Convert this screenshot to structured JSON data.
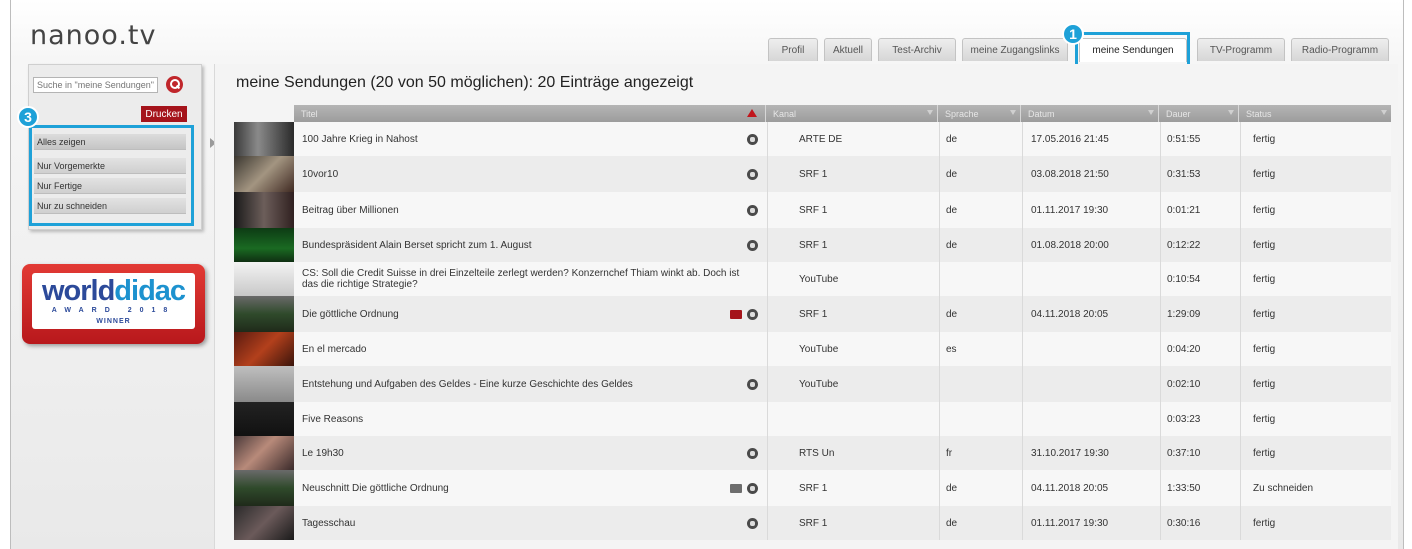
{
  "logo": "nanoo.tv",
  "tabs": [
    "Profil",
    "Aktuell",
    "Test-Archiv",
    "meine Zugangslinks",
    "meine Sendungen",
    "TV-Programm",
    "Radio-Programm"
  ],
  "active_tab": "meine Sendungen",
  "badges": {
    "tab": "1",
    "filters": "3"
  },
  "search": {
    "placeholder": "Suche in \"meine Sendungen\""
  },
  "print_label": "Drucken",
  "filters": [
    "Alles zeigen",
    "Nur Vorgemerkte",
    "Nur Fertige",
    "Nur zu schneiden"
  ],
  "award": {
    "world": "world",
    "didac": "didac",
    "line": "AWARD 2018",
    "winner": "WINNER"
  },
  "page_title": "meine Sendungen (20 von 50 möglichen): 20 Einträge angezeigt",
  "columns": [
    "Titel",
    "Kanal",
    "Sprache",
    "Datum",
    "Dauer",
    "Status"
  ],
  "rows": [
    {
      "title": "100 Jahre Krieg in Nahost",
      "kanal": "ARTE DE",
      "sprache": "de",
      "datum": "17.05.2016 21:45",
      "dauer": "0:51:55",
      "status": "fertig",
      "info": true,
      "folder": ""
    },
    {
      "title": "10vor10",
      "kanal": "SRF 1",
      "sprache": "de",
      "datum": "03.08.2018 21:50",
      "dauer": "0:31:53",
      "status": "fertig",
      "info": true,
      "folder": ""
    },
    {
      "title": "Beitrag über Millionen",
      "kanal": "SRF 1",
      "sprache": "de",
      "datum": "01.11.2017 19:30",
      "dauer": "0:01:21",
      "status": "fertig",
      "info": true,
      "folder": ""
    },
    {
      "title": "Bundespräsident Alain Berset spricht zum 1. August",
      "kanal": "SRF 1",
      "sprache": "de",
      "datum": "01.08.2018 20:00",
      "dauer": "0:12:22",
      "status": "fertig",
      "info": true,
      "folder": ""
    },
    {
      "title": "CS: Soll die Credit Suisse in drei Einzelteile zerlegt werden? Konzernchef Thiam winkt ab. Doch ist das die richtige Strategie?",
      "kanal": "YouTube",
      "sprache": "",
      "datum": "",
      "dauer": "0:10:54",
      "status": "fertig",
      "info": false,
      "folder": ""
    },
    {
      "title": "Die göttliche Ordnung",
      "kanal": "SRF 1",
      "sprache": "de",
      "datum": "04.11.2018 20:05",
      "dauer": "1:29:09",
      "status": "fertig",
      "info": true,
      "folder": "#a5141b"
    },
    {
      "title": "En el mercado",
      "kanal": "YouTube",
      "sprache": "es",
      "datum": "",
      "dauer": "0:04:20",
      "status": "fertig",
      "info": false,
      "folder": ""
    },
    {
      "title": "Entstehung und Aufgaben des Geldes - Eine kurze Geschichte des Geldes",
      "kanal": "YouTube",
      "sprache": "",
      "datum": "",
      "dauer": "0:02:10",
      "status": "fertig",
      "info": true,
      "folder": ""
    },
    {
      "title": "Five Reasons",
      "kanal": "",
      "sprache": "",
      "datum": "",
      "dauer": "0:03:23",
      "status": "fertig",
      "info": false,
      "folder": ""
    },
    {
      "title": "Le 19h30",
      "kanal": "RTS Un",
      "sprache": "fr",
      "datum": "31.10.2017 19:30",
      "dauer": "0:37:10",
      "status": "fertig",
      "info": true,
      "folder": ""
    },
    {
      "title": "Neuschnitt Die göttliche Ordnung",
      "kanal": "SRF 1",
      "sprache": "de",
      "datum": "04.11.2018 20:05",
      "dauer": "1:33:50",
      "status": "Zu schneiden",
      "info": true,
      "folder": "#6d6d6d"
    },
    {
      "title": "Tagesschau",
      "kanal": "SRF 1",
      "sprache": "de",
      "datum": "01.11.2017 19:30",
      "dauer": "0:30:16",
      "status": "fertig",
      "info": true,
      "folder": ""
    }
  ]
}
